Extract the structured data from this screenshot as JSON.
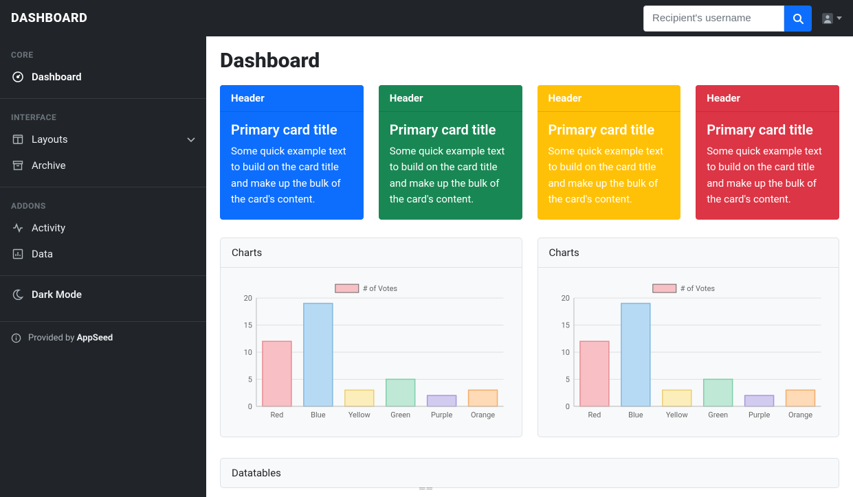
{
  "brand": "DASHBOARD",
  "search": {
    "placeholder": "Recipient's username"
  },
  "sidebar": {
    "sections": [
      {
        "title": "CORE",
        "items": [
          {
            "name": "dashboard",
            "label": "Dashboard",
            "icon": "tachometer",
            "active": true
          }
        ]
      },
      {
        "title": "INTERFACE",
        "items": [
          {
            "name": "layouts",
            "label": "Layouts",
            "icon": "columns",
            "collapsible": true
          },
          {
            "name": "archive",
            "label": "Archive",
            "icon": "archive"
          }
        ]
      },
      {
        "title": "ADDONS",
        "items": [
          {
            "name": "activity",
            "label": "Activity",
            "icon": "activity"
          },
          {
            "name": "data",
            "label": "Data",
            "icon": "bar-chart"
          }
        ]
      }
    ],
    "darkmode_label": "Dark Mode",
    "footer_prefix": "Provided by ",
    "footer_brand": "AppSeed"
  },
  "page": {
    "title": "Dashboard",
    "cards": [
      {
        "color": "blue",
        "header": "Header",
        "title": "Primary card title",
        "text": "Some quick example text to build on the card title and make up the bulk of the card's content."
      },
      {
        "color": "green",
        "header": "Header",
        "title": "Primary card title",
        "text": "Some quick example text to build on the card title and make up the bulk of the card's content."
      },
      {
        "color": "yellow",
        "header": "Header",
        "title": "Primary card title",
        "text": "Some quick example text to build on the card title and make up the bulk of the card's content."
      },
      {
        "color": "red",
        "header": "Header",
        "title": "Primary card title",
        "text": "Some quick example text to build on the card title and make up the bulk of the card's content."
      }
    ],
    "chart_panel_title": "Charts",
    "datatables_title": "Datatables"
  },
  "chart_data": [
    {
      "type": "bar",
      "legend": "# of Votes",
      "categories": [
        "Red",
        "Blue",
        "Yellow",
        "Green",
        "Purple",
        "Orange"
      ],
      "values": [
        12,
        19,
        3,
        5,
        2,
        3
      ],
      "ylim": [
        0,
        20
      ],
      "yticks": [
        0,
        5,
        10,
        15,
        20
      ],
      "colors": {
        "fill": [
          "#f8c0c4",
          "#b7daf4",
          "#fceebb",
          "#bfe8d7",
          "#d2cbf0",
          "#fedab7"
        ],
        "stroke": [
          "#e88a92",
          "#7fb8e0",
          "#eccf72",
          "#7ecfa8",
          "#a598dc",
          "#f3ad6b"
        ]
      }
    },
    {
      "type": "bar",
      "legend": "# of Votes",
      "categories": [
        "Red",
        "Blue",
        "Yellow",
        "Green",
        "Purple",
        "Orange"
      ],
      "values": [
        12,
        19,
        3,
        5,
        2,
        3
      ],
      "ylim": [
        0,
        20
      ],
      "yticks": [
        0,
        5,
        10,
        15,
        20
      ],
      "colors": {
        "fill": [
          "#f8c0c4",
          "#b7daf4",
          "#fceebb",
          "#bfe8d7",
          "#d2cbf0",
          "#fedab7"
        ],
        "stroke": [
          "#e88a92",
          "#7fb8e0",
          "#eccf72",
          "#7ecfa8",
          "#a598dc",
          "#f3ad6b"
        ]
      }
    }
  ]
}
